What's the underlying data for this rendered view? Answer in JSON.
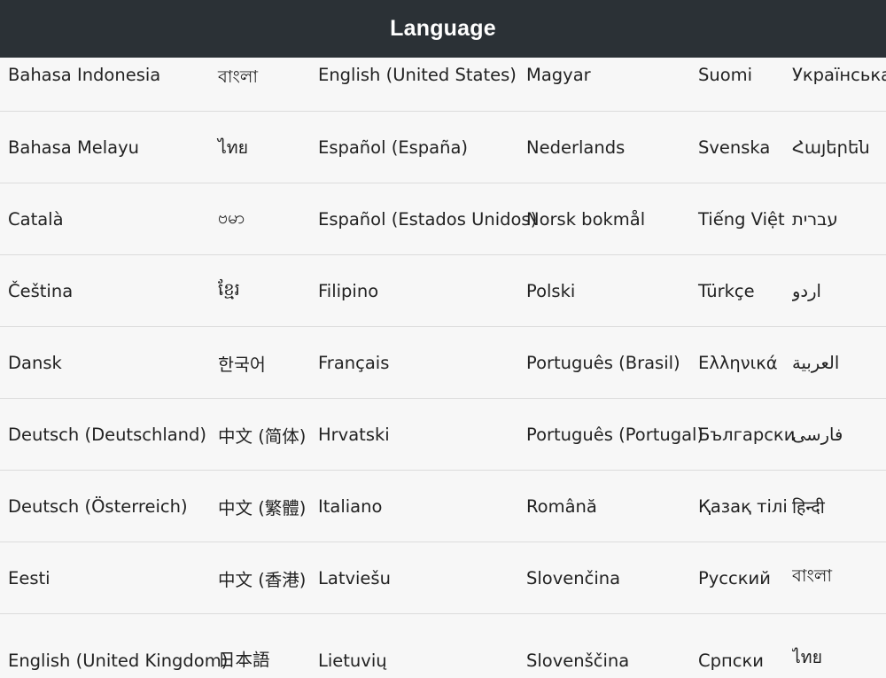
{
  "header": {
    "title": "Language"
  },
  "rows": [
    [
      "Bahasa Indonesia",
      "বাংলা",
      "English (United States)",
      "Magyar",
      "Suomi",
      "Українська"
    ],
    [
      "Bahasa Melayu",
      "ไทย",
      "Español (España)",
      "Nederlands",
      "Svenska",
      "Հայերեն"
    ],
    [
      "Català",
      "ဗမာ",
      "Español (Estados Unidos)",
      "Norsk bokmål",
      "Tiếng Việt",
      "עברית"
    ],
    [
      "Čeština",
      "ខ្មែរ",
      "Filipino",
      "Polski",
      "Türkçe",
      "اردو"
    ],
    [
      "Dansk",
      "한국어",
      "Français",
      "Português (Brasil)",
      "Ελληνικά",
      "العربية"
    ],
    [
      "Deutsch (Deutschland)",
      "中文 (简体)",
      "Hrvatski",
      "Português (Portugal)",
      "Български",
      "فارسی"
    ],
    [
      "Deutsch (Österreich)",
      "中文 (繁體)",
      "Italiano",
      "Română",
      "Қазақ тілі",
      "हिन्दी"
    ],
    [
      "Eesti",
      "中文 (香港)",
      "Latviešu",
      "Slovenčina",
      "Русский",
      "বাংলা"
    ],
    [
      "English (United Kingdom)",
      "日本語",
      "Lietuvių",
      "Slovenščina",
      "Српски",
      "ไทย"
    ]
  ]
}
